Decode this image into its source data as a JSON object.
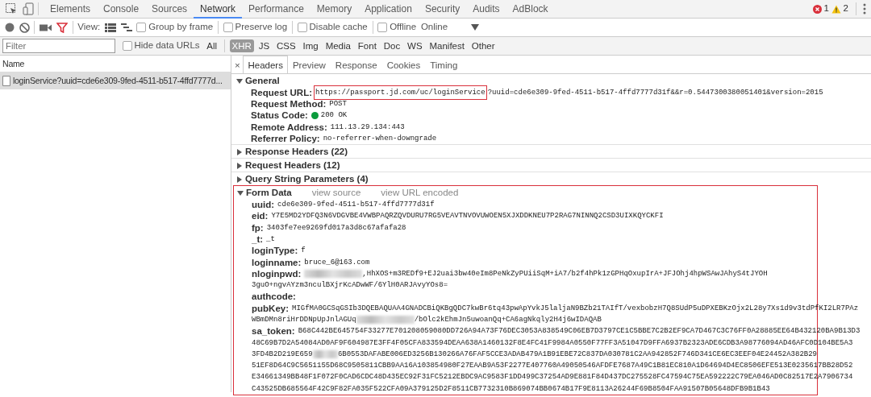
{
  "top_tabs": [
    {
      "label": "Elements",
      "selected": false
    },
    {
      "label": "Console",
      "selected": false
    },
    {
      "label": "Sources",
      "selected": false
    },
    {
      "label": "Network",
      "selected": true
    },
    {
      "label": "Performance",
      "selected": false
    },
    {
      "label": "Memory",
      "selected": false
    },
    {
      "label": "Application",
      "selected": false
    },
    {
      "label": "Security",
      "selected": false
    },
    {
      "label": "Audits",
      "selected": false
    },
    {
      "label": "AdBlock",
      "selected": false
    }
  ],
  "error_count": "1",
  "warning_count": "2",
  "toolbar": {
    "recording": true,
    "filter_active": true,
    "view_label": "View:",
    "options": [
      {
        "label": "Group by frame",
        "checked": false
      },
      {
        "label": "Preserve log",
        "checked": false
      },
      {
        "label": "Disable cache",
        "checked": false
      },
      {
        "label": "Offline",
        "checked": false
      }
    ],
    "throttling": "Online"
  },
  "filter_bar": {
    "placeholder": "Filter",
    "hide_data_urls": {
      "label": "Hide data URLs",
      "checked": false
    },
    "types": [
      {
        "label": "All",
        "selected": false
      },
      {
        "label": "XHR",
        "selected": true
      },
      {
        "label": "JS",
        "selected": false
      },
      {
        "label": "CSS",
        "selected": false
      },
      {
        "label": "Img",
        "selected": false
      },
      {
        "label": "Media",
        "selected": false
      },
      {
        "label": "Font",
        "selected": false
      },
      {
        "label": "Doc",
        "selected": false
      },
      {
        "label": "WS",
        "selected": false
      },
      {
        "label": "Manifest",
        "selected": false
      },
      {
        "label": "Other",
        "selected": false
      }
    ]
  },
  "requests": {
    "column": "Name",
    "rows": [
      {
        "name": "loginService?uuid=cde6e309-9fed-4511-b517-4ffd7777d...",
        "selected": true
      }
    ]
  },
  "detail_tabs": {
    "close": "×",
    "tabs": [
      {
        "label": "Headers",
        "selected": true
      },
      {
        "label": "Preview",
        "selected": false
      },
      {
        "label": "Response",
        "selected": false
      },
      {
        "label": "Cookies",
        "selected": false
      },
      {
        "label": "Timing",
        "selected": false
      }
    ]
  },
  "sections": [
    {
      "title": "General",
      "expanded": true,
      "highlighted": false,
      "fields": [
        {
          "key": "Request URL:",
          "lines": [
            [
              {
                "kind": "text",
                "text": "https://passport.jd.com/uc/loginService",
                "highlighted": true
              },
              {
                "kind": "text",
                "text": "?uuid=cde6e309-9fed-4511-b517-4ffd7777d31f&&r=0.5447300380051401&version=2015",
                "highlighted": false
              }
            ]
          ]
        },
        {
          "key": "Request Method:",
          "lines": [
            [
              {
                "kind": "text",
                "text": "POST",
                "highlighted": false
              }
            ]
          ]
        },
        {
          "key": "Status Code:",
          "status_ok": true,
          "lines": [
            [
              {
                "kind": "text",
                "text": "200 OK",
                "highlighted": false
              }
            ]
          ]
        },
        {
          "key": "Remote Address:",
          "lines": [
            [
              {
                "kind": "text",
                "text": "111.13.29.134:443",
                "highlighted": false
              }
            ]
          ]
        },
        {
          "key": "Referrer Policy:",
          "lines": [
            [
              {
                "kind": "text",
                "text": "no-referrer-when-downgrade",
                "highlighted": false
              }
            ]
          ]
        }
      ]
    },
    {
      "title": "Response Headers (22)",
      "expanded": false,
      "highlighted": false
    },
    {
      "title": "Request Headers (12)",
      "expanded": false,
      "highlighted": false
    },
    {
      "title": "Query String Parameters (4)",
      "expanded": false,
      "highlighted": false
    },
    {
      "title": "Form Data",
      "expanded": true,
      "highlighted": true,
      "links": [
        "view source",
        "view URL encoded"
      ],
      "fields": [
        {
          "key": "uuid:",
          "lines": [
            [
              {
                "kind": "text",
                "text": "cde6e309-9fed-4511-b517-4ffd7777d31f",
                "highlighted": false
              }
            ]
          ]
        },
        {
          "key": "eid:",
          "lines": [
            [
              {
                "kind": "text",
                "text": "Y7E5MD2YDFQ3N6VDGVBE4VWBPAQRZQVDURU7RG5VEAVTNVOVUWOEN5XJXDDKNEU7P2RAG7NINNQ2CSD3UIXKQYCKFI",
                "highlighted": false
              }
            ]
          ]
        },
        {
          "key": "fp:",
          "lines": [
            [
              {
                "kind": "text",
                "text": "3403fe7ee9269fd017a3d8c67afafa28",
                "highlighted": false
              }
            ]
          ]
        },
        {
          "key": "_t:",
          "lines": [
            [
              {
                "kind": "text",
                "text": "_t",
                "highlighted": false
              }
            ]
          ]
        },
        {
          "key": "loginType:",
          "lines": [
            [
              {
                "kind": "text",
                "text": "f",
                "highlighted": false
              }
            ]
          ]
        },
        {
          "key": "loginname:",
          "lines": [
            [
              {
                "kind": "text",
                "text": "bruce_6@163.com",
                "highlighted": false
              }
            ]
          ]
        },
        {
          "key": "nloginpwd:",
          "lines": [
            [
              {
                "kind": "blur"
              },
              {
                "kind": "text",
                "text": ",HhXOS+m3REDf9+EJ2uai3bw40eIm8PeNkZyPUiiSqM+iA7/b2f4hPk1zGPHqOxupIrA+JFJOhj4hpWSAwJAhyS4tJYOH",
                "highlighted": false
              }
            ],
            [
              {
                "kind": "text",
                "text": "3guO+ngvAYzm3nculBXjrKcADwWF/6YlH0ARJAvyYOs8=",
                "highlighted": false
              }
            ]
          ]
        },
        {
          "key": "authcode:"
        },
        {
          "key": "pubKey:",
          "lines": [
            [
              {
                "kind": "text",
                "text": "MIGfMA0GCSqGSIb3DQEBAQUAA4GNADCBiQKBgQDC7kwBr6tq43pwApYvkJ5laljaN9BZb21TAIfT/vexbobzH7Q8SUdP5uDPXEBKzOjx2L28y7Xs1d9v3tdPfKI2LR7PAz",
                "highlighted": false
              }
            ],
            [
              {
                "kind": "text",
                "text": "WBmDMn8riHrDDNpUpJnlAGUq",
                "highlighted": false
              },
              {
                "kind": "blur"
              },
              {
                "kind": "text",
                "text": "/bOlc2kEhmJn5uwoanQq+CA6agNkqly2H4j6wIDAQAB",
                "highlighted": false
              }
            ]
          ]
        },
        {
          "key": "sa_token:",
          "lines": [
            [
              {
                "kind": "text",
                "text": "B68C442BE645754F33277E701208059080DD726A94A73F76DEC3053A838549C06EB7D3797CE1C5BBE7C2B2EF9CA7D467C3C76FF0A28885EE64B432120BA9B13D3",
                "highlighted": false
              }
            ],
            [
              {
                "kind": "text",
                "text": "48C69B7D2A54084AD0AF9F604987E3FF4F05CFA833594DEAA638A1460132F8E4FC41F9984A0550F77FF3A51047D9FFA6937B2323ADE6CDB3A98776094AD46AFC0D104BE5A3",
                "highlighted": false
              }
            ],
            [
              {
                "kind": "text",
                "text": "3FD4B2D219E659",
                "highlighted": false
              },
              {
                "kind": "blur"
              },
              {
                "kind": "text",
                "text": "6B0553DAFABE006ED3256B130266A76FAF5CCE3ADAB479A1B91EBE72C837DA030781C2AA942852F746D341CE6EC3EEF04E24452A382B29",
                "highlighted": false
              }
            ],
            [
              {
                "kind": "text",
                "text": "51EF8D64C9C5651155D68C9505811CBB9AA16A103854980F27EAAB9A53F2277E407760A49050546AFDFE7687A49C1B81EC810A1D64694D4EC8506EFE513E0235617BB28D52",
                "highlighted": false
              }
            ],
            [
              {
                "kind": "text",
                "text": "E34661349BB48F1F072F0CAD6CDC48D435EC92F31FC5212EBDC9AC9583F1DD499C37254AD9E881F84D437DC275528FC47594C75EA592222C79EA046AD0C82517E2A7906734",
                "highlighted": false
              }
            ],
            [
              {
                "kind": "text",
                "text": "C43525DB685564F42C9F82FA035F522CFA09A379125D2F8511CB7732310B869074BB0674B17F9E8113A26244F69B8504FAA91507B05648DFB9B1B43",
                "highlighted": false
              }
            ]
          ]
        }
      ]
    }
  ]
}
